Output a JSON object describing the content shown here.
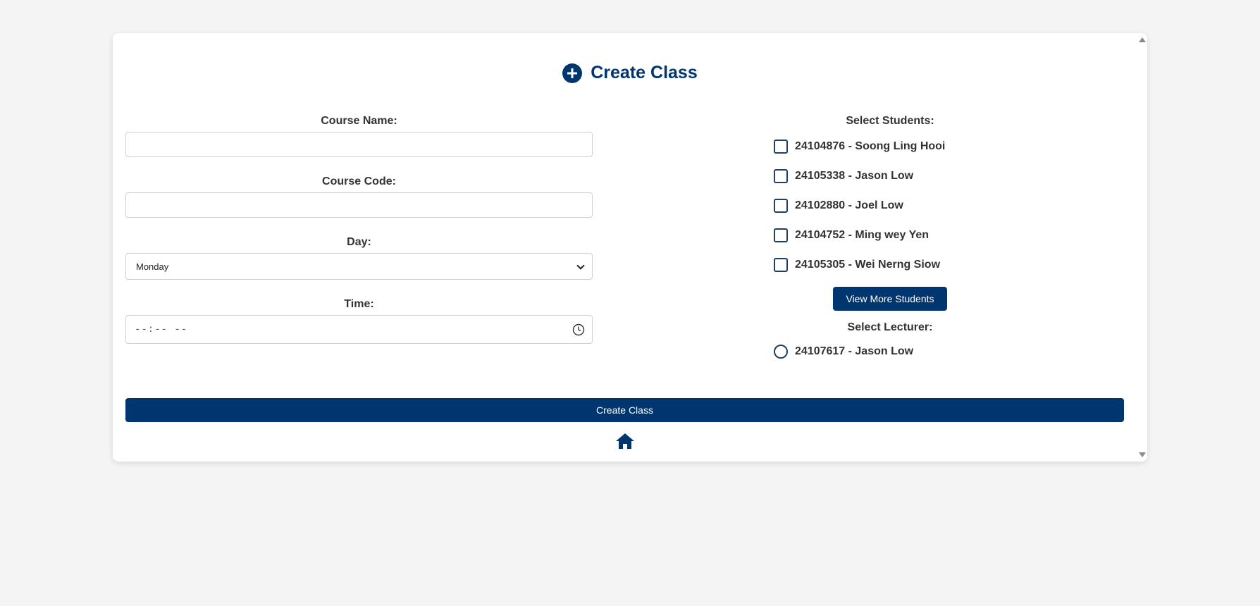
{
  "header": {
    "title": "Create Class",
    "icon": "plus-circle-icon"
  },
  "form": {
    "course_name_label": "Course Name:",
    "course_name_value": "",
    "course_code_label": "Course Code:",
    "course_code_value": "",
    "day_label": "Day:",
    "day_value": "Monday",
    "time_label": "Time:",
    "time_value": "--:-- --"
  },
  "students": {
    "label": "Select Students:",
    "items": [
      {
        "label": "24104876 - Soong Ling Hooi",
        "checked": false
      },
      {
        "label": "24105338 - Jason Low",
        "checked": false
      },
      {
        "label": "24102880 - Joel Low",
        "checked": false
      },
      {
        "label": "24104752 - Ming wey Yen",
        "checked": false
      },
      {
        "label": "24105305 - Wei Nerng Siow",
        "checked": false
      }
    ],
    "view_more_label": "View More Students"
  },
  "lecturer": {
    "label": "Select Lecturer:",
    "items": [
      {
        "label": "24107617 - Jason Low",
        "selected": false
      }
    ]
  },
  "actions": {
    "create_label": "Create Class",
    "home_icon": "home-icon"
  },
  "colors": {
    "primary": "#003670",
    "background": "#f4f4f4",
    "card": "#ffffff",
    "text": "#333333"
  }
}
